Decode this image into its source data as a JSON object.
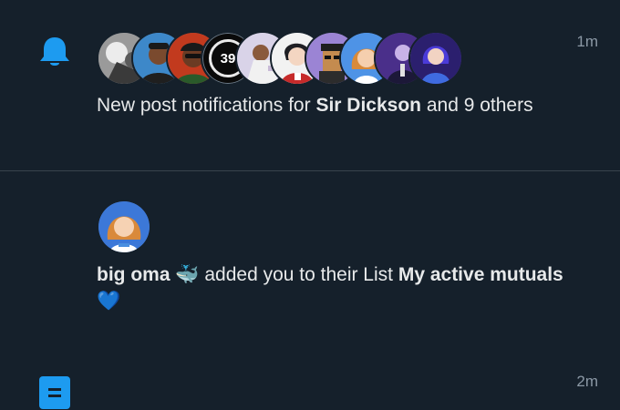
{
  "notifications": [
    {
      "type_icon": "bell-icon",
      "time": "1m",
      "avatar_count_label": "39",
      "text_prefix": "New post notifications for ",
      "text_name": "Sir Dickson",
      "text_suffix": " and 9 others"
    },
    {
      "type_icon": "list-icon",
      "time": "2m",
      "actor_name": "big oma",
      "actor_emoji": "🐳",
      "text_middle": " added you to their List ",
      "list_name": "My active mutuals",
      "trailing_emoji": "💙"
    }
  ],
  "colors": {
    "background": "#15202b",
    "accent": "#1d9bf0",
    "text_primary": "#e7e9ea",
    "text_secondary": "#8b98a5",
    "divider": "#38444d"
  }
}
